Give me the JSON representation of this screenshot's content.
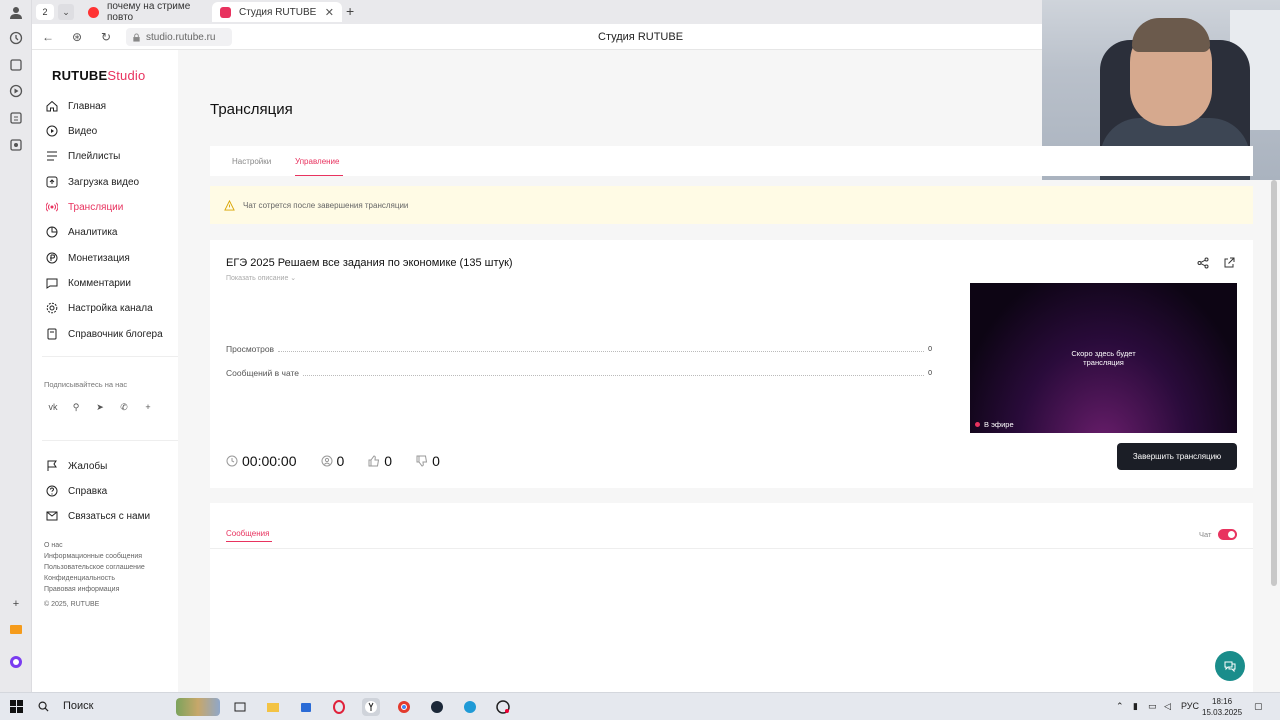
{
  "browser": {
    "tab_count": "2",
    "tabs": [
      {
        "label": "почему на стриме повто"
      },
      {
        "label": "Студия RUTUBE"
      }
    ],
    "url": "studio.rutube.ru",
    "page_title": "Студия RUTUBE"
  },
  "sidebar": {
    "logo_main": "RUTUBE",
    "logo_studio": "Studio",
    "items": [
      {
        "label": "Главная",
        "icon": "home-icon"
      },
      {
        "label": "Видео",
        "icon": "video-icon"
      },
      {
        "label": "Плейлисты",
        "icon": "playlist-icon"
      },
      {
        "label": "Загрузка видео",
        "icon": "upload-icon"
      },
      {
        "label": "Трансляции",
        "icon": "broadcast-icon",
        "active": true
      },
      {
        "label": "Аналитика",
        "icon": "analytics-icon"
      },
      {
        "label": "Монетизация",
        "icon": "monetization-icon"
      },
      {
        "label": "Комментарии",
        "icon": "comments-icon"
      },
      {
        "label": "Настройка канала",
        "icon": "settings-icon"
      },
      {
        "label": "Справочник блогера",
        "icon": "book-icon"
      }
    ],
    "subscribe_label": "Подписывайтесь на нас",
    "bottom_items": [
      {
        "label": "Жалобы",
        "icon": "flag-icon"
      },
      {
        "label": "Справка",
        "icon": "help-icon"
      },
      {
        "label": "Связаться с нами",
        "icon": "mail-icon"
      }
    ],
    "footer_links": [
      "О нас",
      "Информационные сообщения",
      "Пользовательское соглашение",
      "Конфиденциальность",
      "Правовая информация"
    ],
    "copyright": "© 2025, RUTUBE"
  },
  "main": {
    "title": "Трансляция",
    "tabs": [
      {
        "label": "Настройки"
      },
      {
        "label": "Управление",
        "active": true
      }
    ],
    "warning": "Чат сотрется после завершения трансляции",
    "stream": {
      "title": "ЕГЭ 2025 Решаем все задания по экономике (135 штук)",
      "show_description": "Показать описание",
      "stats": [
        {
          "label": "Просмотров",
          "value": "0"
        },
        {
          "label": "Сообщений в чате",
          "value": "0"
        }
      ],
      "timer": "00:00:00",
      "viewers": "0",
      "likes": "0",
      "dislikes": "0",
      "preview_message_1": "Скоро здесь будет",
      "preview_message_2": "трансляция",
      "live_label": "В эфире",
      "end_button": "Завершить трансляцию"
    },
    "chat": {
      "tab_label": "Сообщения",
      "chat_label": "Чат",
      "enabled": true
    }
  },
  "taskbar": {
    "search_label": "Поиск",
    "lang": "РУС",
    "time": "18:16",
    "date": "15.03.2025"
  },
  "colors": {
    "accent": "#e8335f",
    "dark_button": "#1b1e26",
    "warning_bg": "#fffbe5",
    "fab": "#1a8d8b"
  }
}
